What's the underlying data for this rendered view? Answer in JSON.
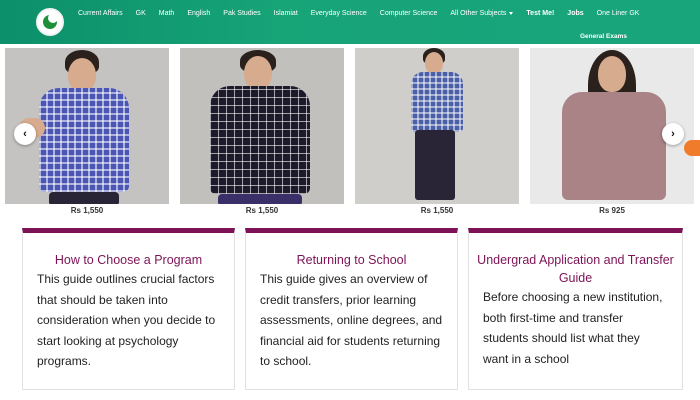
{
  "nav": {
    "items": [
      {
        "label": "Current Affairs",
        "bold": false
      },
      {
        "label": "GK",
        "bold": false
      },
      {
        "label": "Math",
        "bold": false
      },
      {
        "label": "English",
        "bold": false
      },
      {
        "label": "Pak Studies",
        "bold": false
      },
      {
        "label": "Islamiat",
        "bold": false
      },
      {
        "label": "Everyday Science",
        "bold": false
      },
      {
        "label": "Computer Science",
        "bold": false
      },
      {
        "label": "All Other Subjects",
        "bold": false
      },
      {
        "label": "Test Me!",
        "bold": true
      },
      {
        "label": "Jobs",
        "bold": true
      },
      {
        "label": "One Liner GK",
        "bold": false
      }
    ],
    "row2": "General Exams",
    "colors": {
      "bar": "#17a477",
      "text": "#ffffff"
    }
  },
  "products": [
    {
      "price": "Rs 1,550",
      "shirt": "blue-check-shirt"
    },
    {
      "price": "Rs 1,550",
      "shirt": "dark-check-shirt"
    },
    {
      "price": "Rs 1,550",
      "shirt": "blue-check-shirt"
    },
    {
      "price": "Rs 925",
      "shirt": "mauve-shirt"
    }
  ],
  "carousel": {
    "prev": "‹",
    "next": "›"
  },
  "guides": [
    {
      "title": "How to Choose a Program",
      "body": "This guide outlines crucial factors that should be taken into consideration when you decide to start looking at psychology programs."
    },
    {
      "title": "Returning to School",
      "body": "This guide gives an overview of credit transfers, prior learning assessments, online degrees, and financial aid for students returning to school."
    },
    {
      "title": "Undergrad Application and Transfer Guide",
      "body": "Before choosing a new institution, both first-time and transfer students should list what they want in a school"
    }
  ],
  "accent": "#7d1356"
}
